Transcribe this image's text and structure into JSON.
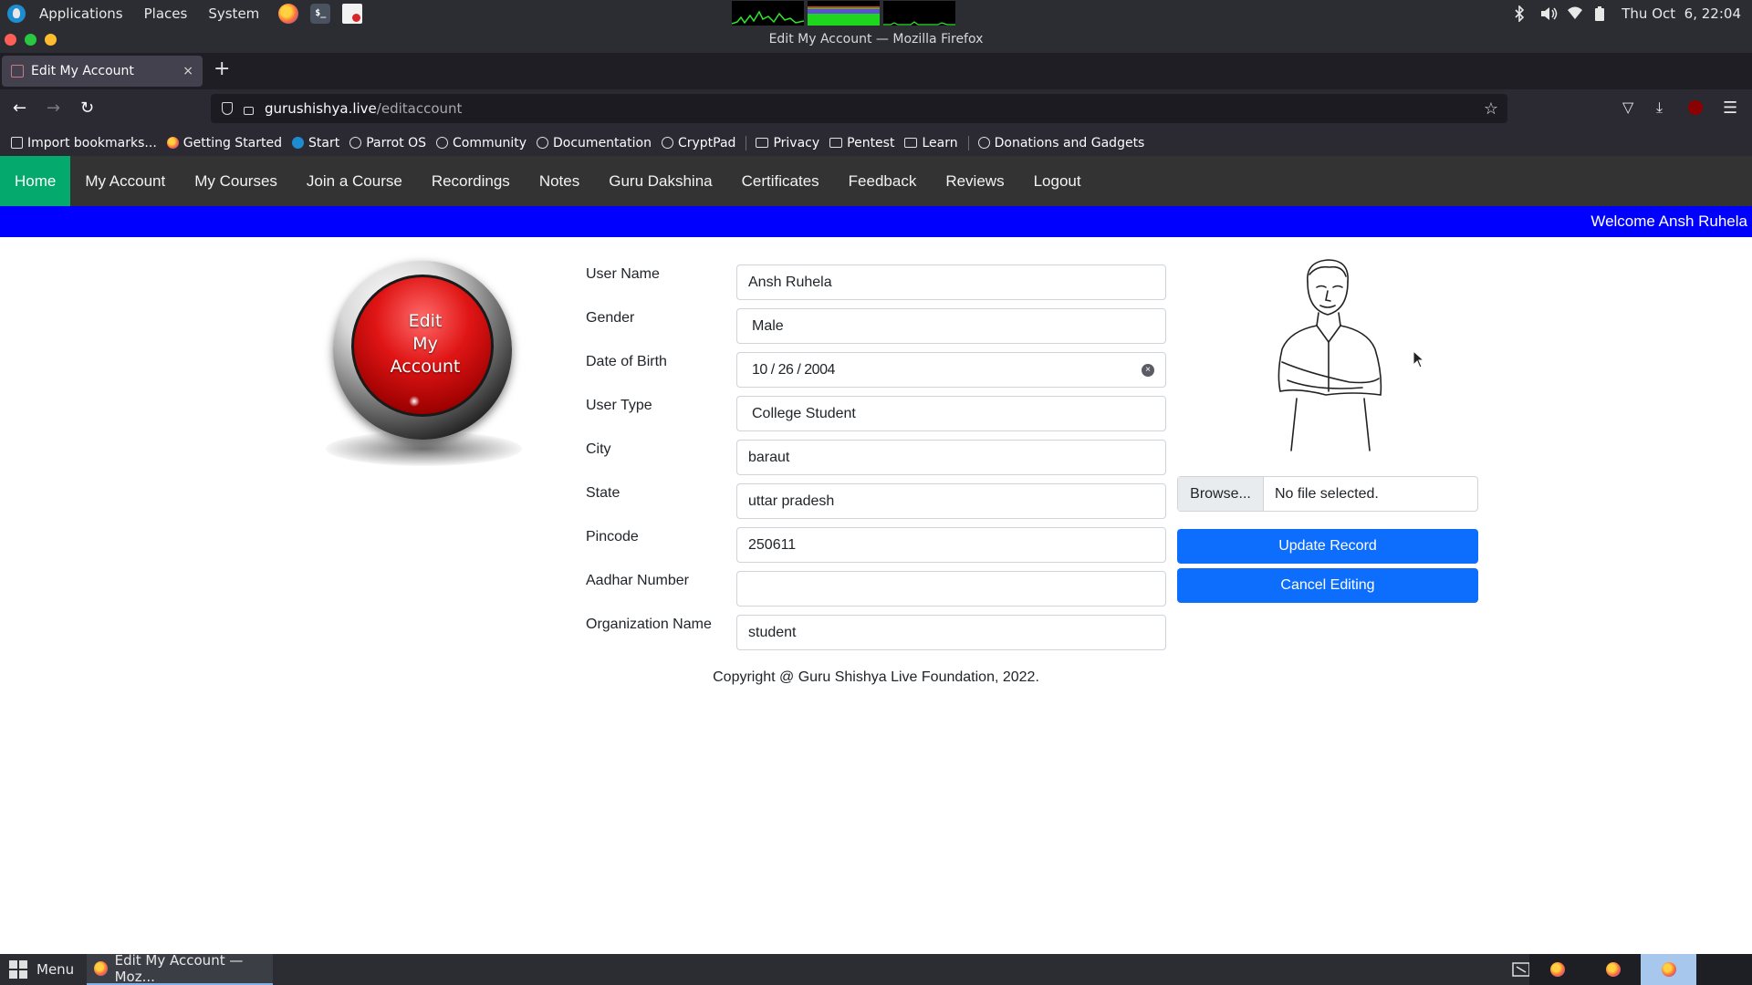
{
  "os_panel": {
    "menus": [
      "Applications",
      "Places",
      "System"
    ],
    "clock": "Thu Oct  6, 22:04"
  },
  "window": {
    "title": "Edit My Account — Mozilla Firefox"
  },
  "browser": {
    "tab_title": "Edit My Account",
    "tab_close": "×",
    "new_tab": "+",
    "url_host": "gurushishya.live",
    "url_path": "/editaccount",
    "bookmarks": [
      {
        "label": "Import bookmarks...",
        "icon": "import-icon"
      },
      {
        "label": "Getting Started",
        "icon": "firefox-icon"
      },
      {
        "label": "Start",
        "icon": "parrot-icon"
      },
      {
        "label": "Parrot OS",
        "icon": "globe-icon"
      },
      {
        "label": "Community",
        "icon": "globe-icon"
      },
      {
        "label": "Documentation",
        "icon": "globe-icon"
      },
      {
        "label": "CryptPad",
        "icon": "globe-icon"
      },
      {
        "label": "Privacy",
        "icon": "folder-icon"
      },
      {
        "label": "Pentest",
        "icon": "folder-icon"
      },
      {
        "label": "Learn",
        "icon": "folder-icon"
      },
      {
        "label": "Donations and Gadgets",
        "icon": "globe-icon"
      }
    ]
  },
  "site": {
    "nav": [
      "Home",
      "My Account",
      "My Courses",
      "Join a Course",
      "Recordings",
      "Notes",
      "Guru Dakshina",
      "Certificates",
      "Feedback",
      "Reviews",
      "Logout"
    ],
    "active_nav": "Home",
    "welcome": "Welcome Ansh Ruhela",
    "emblem_lines": [
      "Edit",
      "My",
      "Account"
    ],
    "form": {
      "user_name": {
        "label": "User Name",
        "value": "Ansh Ruhela"
      },
      "gender": {
        "label": "Gender",
        "value": "Male"
      },
      "dob": {
        "label": "Date of Birth",
        "value": "10 / 26 / 2004"
      },
      "user_type": {
        "label": "User Type",
        "value": "College Student"
      },
      "city": {
        "label": "City",
        "value": "baraut"
      },
      "state": {
        "label": "State",
        "value": "uttar pradesh"
      },
      "pincode": {
        "label": "Pincode",
        "value": "250611"
      },
      "aadhar": {
        "label": "Aadhar Number",
        "value": ""
      },
      "organization": {
        "label": "Organization Name",
        "value": "student"
      }
    },
    "file": {
      "browse": "Browse...",
      "status": "No file selected."
    },
    "update_button": "Update Record",
    "cancel_button": "Cancel Editing",
    "copyright": "Copyright @ Guru Shishya Live Foundation, 2022."
  },
  "taskbar": {
    "menu_label": "Menu",
    "task_label": "Edit My Account — Moz..."
  },
  "colors": {
    "nav_bg": "#333333",
    "nav_active": "#04aa6d",
    "welcome_bar": "#0000ff",
    "primary_button": "#0d6efd"
  }
}
